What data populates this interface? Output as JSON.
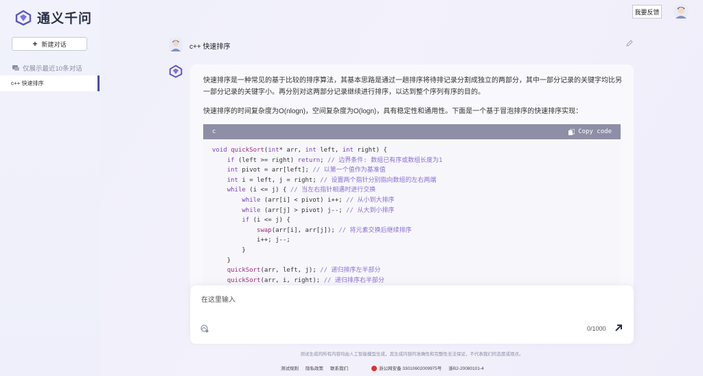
{
  "app": {
    "name": "通义千问"
  },
  "sidebar": {
    "new_chat_label": "新建对话",
    "history_hint": "仅展示最近10条对话",
    "history": [
      {
        "title": "c++ 快速排序"
      }
    ]
  },
  "header": {
    "feedback_label": "我要反馈"
  },
  "chat": {
    "user_message": "c++ 快速排序",
    "answer": {
      "para1": "快速排序是一种常见的基于比较的排序算法，其基本思路是通过一趟排序将待排记录分割成独立的两部分，其中一部分记录的关键字均比另一部分记录的关键字小。再分别对这两部分记录继续进行排序，以达到整个序列有序的目的。",
      "para2": "快速排序的时间复杂度为O(nlogn)，空间复杂度为O(logn)，具有稳定性和通用性。下面是一个基于冒泡排序的快速排序实现：",
      "code_lang": "c",
      "copy_label": "Copy code",
      "code_lines": [
        "void quickSort(int* arr, int left, int right) {",
        "    if (left >= right) return; // 边界条件: 数组已有序或数组长度为1",
        "    int pivot = arr[left]; // 以第一个值作为基准值",
        "    int i = left, j = right; // 设置两个指针分别指向数组的左右两端",
        "    while (i <= j) { // 当左右指针相遇时进行交换",
        "        while (arr[i] < pivot) i++; // 从小到大排序",
        "        while (arr[j] > pivot) j--; // 从大到小排序",
        "        if (i <= j) {",
        "            swap(arr[i], arr[j]); // 将元素交换后继续排序",
        "            i++; j--;",
        "        }",
        "    }",
        "    quickSort(arr, left, j); // 递归排序左半部分",
        "    quickSort(arr, i, right); // 递归排序右半部分"
      ]
    }
  },
  "input": {
    "placeholder": "在这里输入",
    "counter": "0/1000"
  },
  "footer": {
    "disclaimer": "测试生成的所有内容均由人工智能模型生成，其生成内容的准确性和完整性无法保证，不代表我们的态度或观点。",
    "links": [
      "测试规则",
      "隐私政策",
      "联系我们"
    ],
    "beian": "浙公网安备 33010602009975号",
    "icp": "浙B2-20080101-4"
  },
  "colors": {
    "accent": "#4a4fa8",
    "code_header": "#8e8ea6"
  }
}
